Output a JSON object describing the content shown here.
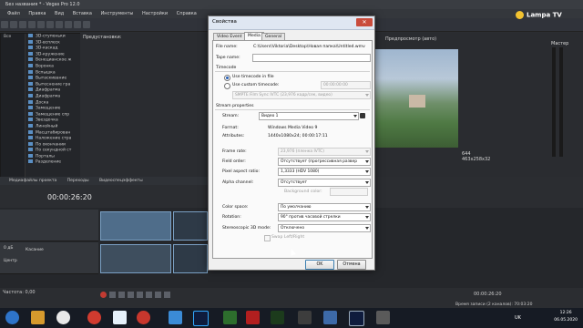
{
  "app": {
    "title": "Без названия * - Vegas Pro 12.0",
    "menu": [
      "Файл",
      "Правка",
      "Вид",
      "Вставка",
      "Инструменты",
      "Настройки",
      "Справка"
    ]
  },
  "explorer": {
    "tree_root": "Все",
    "items": [
      "3D-ступеньки",
      "3D-всплеск",
      "3D-каскад",
      "3D-кружение",
      "Венецианское ж",
      "Воронка",
      "Вспышка",
      "Вытаскивание",
      "Вытеснение гра",
      "Диафрагма",
      "Диафрагма",
      "Доска",
      "Замещение",
      "Замещение спр",
      "Звездочка",
      "Линейный",
      "Масштабирован",
      "Наложение стра",
      "По окончании",
      "По секундной ст",
      "Порталы",
      "Разделение"
    ]
  },
  "fx_panel": {
    "label": "Предустановки:"
  },
  "preview": {
    "label": "Предпросмотр (авто)",
    "frame": "644",
    "display": "463x258x32"
  },
  "master": {
    "label": "Мастер"
  },
  "tabs_bottom": [
    "Медиафайлы проекта",
    "Переходы",
    "Видеоспецэффекты"
  ],
  "timeline": {
    "timecode": "00:00:26:20",
    "track1_label": "",
    "track2_label": "Касание",
    "track2_level": "0 дБ",
    "track2_pan": "Центр",
    "rate": "Частота: 0,00",
    "end_timecode": "00:00:26:20",
    "record_info": "Время записи (2 каналов): 70:03:20"
  },
  "taskbar": {
    "lang": "UK",
    "time": "12:26",
    "date": "06.05.2020"
  },
  "logo": {
    "text": "Lampa TV"
  },
  "dialog": {
    "title": "Свойства",
    "close": "✕",
    "tabs": [
      "Video Event",
      "Media",
      "General"
    ],
    "active_tab": "Media",
    "file_name_label": "File name:",
    "file_name_value": "C:\\Users\\Viktoria\\Desktop\\Новая папка\\Untitled.wmv",
    "tape_name_label": "Tape name:",
    "tape_name_value": "",
    "timecode_section": "Timecode",
    "use_timecode_file": "Use timecode in file",
    "use_custom_timecode": "Use custom timecode:",
    "custom_timecode_value": "00:00:00:00",
    "timecode_format": "SMPTE Film Sync IVTC (23,976 кадр/сек, видео)",
    "stream_section": "Stream properties",
    "stream_label": "Stream:",
    "stream_value": "Видео 1",
    "format_label": "Format:",
    "format_value": "Windows Media Video 9",
    "attributes_label": "Attributes:",
    "attributes_value": "1440x1080x24; 00:00:17:11",
    "frame_rate_label": "Frame rate:",
    "frame_rate_value": "23,976 (пленка IVTC)",
    "field_order_label": "Field order:",
    "field_order_value": "Отсутствует (прогрессивная развер",
    "pixel_aspect_label": "Pixel aspect ratio:",
    "pixel_aspect_value": "1,3333 (HDV 1080)",
    "alpha_label": "Alpha channel:",
    "alpha_value": "Отсутствует",
    "bg_color_label": "Background color:",
    "color_space_label": "Color space:",
    "color_space_value": "По умолчанию",
    "rotation_label": "Rotation:",
    "rotation_value": "90° против часовой стрелки",
    "stereo_label": "Stereoscopic 3D mode:",
    "stereo_value": "Отключено",
    "swap_label": "Swap Left/Right",
    "ok": "OK",
    "cancel": "Отмена"
  }
}
